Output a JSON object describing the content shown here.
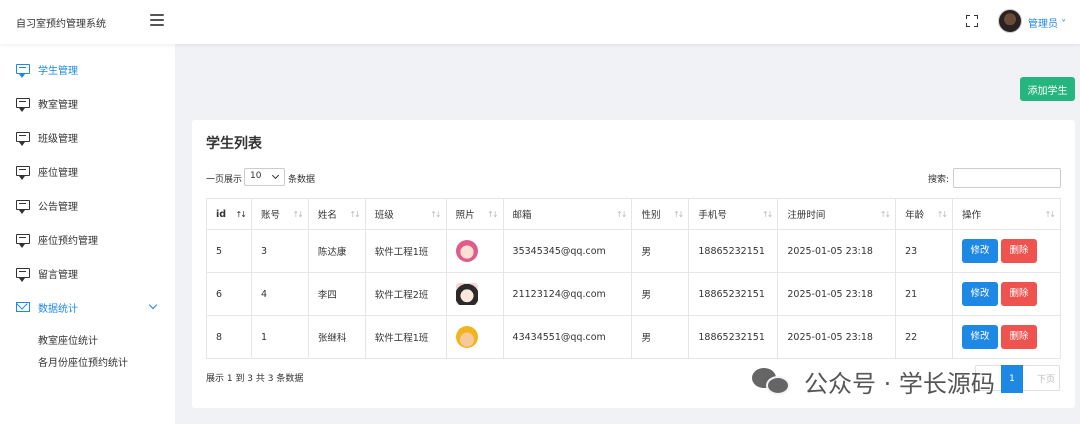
{
  "header": {
    "app_title": "自习室预约管理系统",
    "user_name": "管理员"
  },
  "sidebar": {
    "items": [
      {
        "label": "学生管理",
        "icon": "message-icon"
      },
      {
        "label": "教室管理",
        "icon": "message-icon"
      },
      {
        "label": "班级管理",
        "icon": "message-icon"
      },
      {
        "label": "座位管理",
        "icon": "message-icon"
      },
      {
        "label": "公告管理",
        "icon": "message-icon"
      },
      {
        "label": "座位预约管理",
        "icon": "message-icon"
      },
      {
        "label": "留言管理",
        "icon": "message-icon"
      }
    ],
    "stats": {
      "label": "数据统计",
      "icon": "mail-icon",
      "sub_items": [
        "教室座位统计",
        "各月份座位预约统计"
      ]
    }
  },
  "main": {
    "add_button": "添加学生",
    "card_title": "学生列表",
    "page_length": {
      "prefix": "一页展示",
      "value": "10",
      "suffix": "条数据"
    },
    "search": {
      "label": "搜索:",
      "value": ""
    },
    "table": {
      "headers": [
        "id",
        "账号",
        "姓名",
        "班级",
        "照片",
        "邮箱",
        "性别",
        "手机号",
        "注册时间",
        "年龄",
        "操作"
      ],
      "rows": [
        {
          "id": "5",
          "account": "3",
          "name": "陈达康",
          "class": "软件工程1班",
          "photo": "avatar-girl",
          "email": "35345345@qq.com",
          "gender": "男",
          "phone": "18865232151",
          "reg_time": "2025-01-05 23:18",
          "age": "23"
        },
        {
          "id": "6",
          "account": "4",
          "name": "李四",
          "class": "软件工程2班",
          "photo": "avatar-anime",
          "email": "21123124@qq.com",
          "gender": "男",
          "phone": "18865232151",
          "reg_time": "2025-01-05 23:18",
          "age": "21"
        },
        {
          "id": "8",
          "account": "1",
          "name": "张继科",
          "class": "软件工程1班",
          "photo": "avatar-worker",
          "email": "43434551@qq.com",
          "gender": "男",
          "phone": "18865232151",
          "reg_time": "2025-01-05 23:18",
          "age": "22"
        }
      ],
      "edit_label": "修改",
      "delete_label": "删除"
    },
    "info_text": "展示 1 到 3 共 3 条数据",
    "pagination": {
      "current": "1",
      "next_label": "下页"
    }
  },
  "watermark": "公众号 · 学长源码",
  "colors": {
    "accent": "#1e88e5",
    "success": "#26b47f",
    "danger": "#ef5350",
    "background": "#f1f2f6"
  }
}
